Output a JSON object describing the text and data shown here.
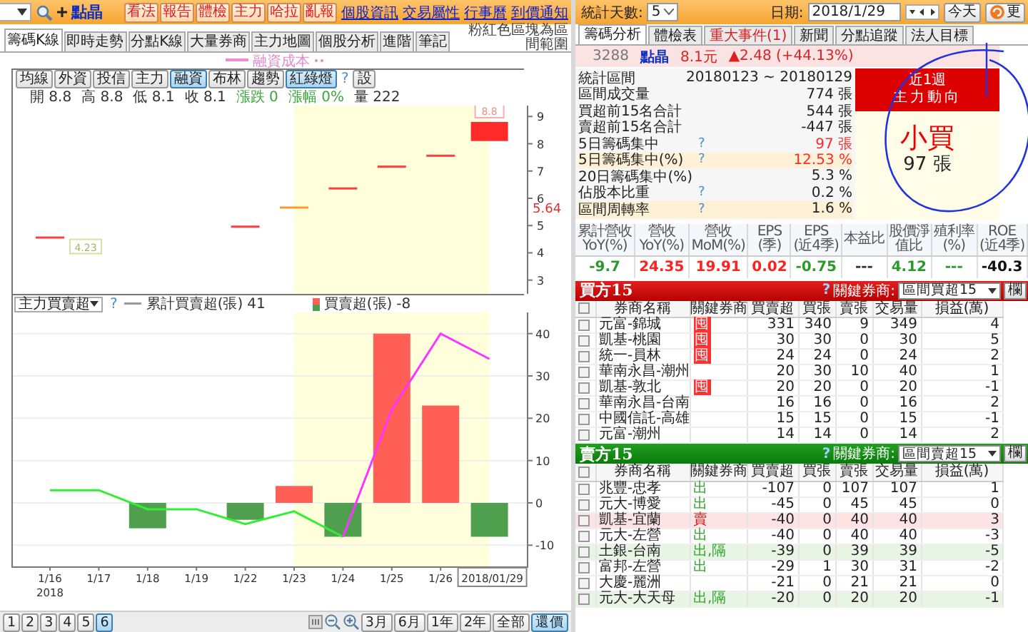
{
  "left_toolbar": {
    "stock_name": "點晶",
    "buttons": [
      "看法",
      "報告",
      "體檢",
      "主力",
      "哈拉",
      "亂報"
    ],
    "links": [
      "個股資訊",
      "交易屬性",
      "行事曆",
      "到價通知"
    ]
  },
  "left_tabs": [
    {
      "label": "籌碼K線",
      "selected": true
    },
    {
      "label": "即時走勢",
      "selected": false
    },
    {
      "label": "分點K線",
      "selected": false
    },
    {
      "label": "大量券商",
      "selected": false
    },
    {
      "label": "主力地圖",
      "selected": false
    },
    {
      "label": "個股分析",
      "selected": false
    },
    {
      "label": "進階",
      "selected": false
    },
    {
      "label": "筆記",
      "selected": false
    }
  ],
  "left_note": "粉紅色區塊為區間範圍",
  "overlay_legend": "融資成本",
  "chart_buttons": [
    {
      "label": "均線",
      "selected": false
    },
    {
      "label": "外資",
      "selected": false
    },
    {
      "label": "投信",
      "selected": false
    },
    {
      "label": "主力",
      "selected": false
    },
    {
      "label": "融資",
      "selected": true
    },
    {
      "label": "布林",
      "selected": false
    },
    {
      "label": "趨勢",
      "selected": false
    },
    {
      "label": "紅綠燈",
      "selected": true
    }
  ],
  "chart_help": "?",
  "chart_settings": "設",
  "ohlc": [
    {
      "label": "開",
      "value": "8.8",
      "color": "#333333"
    },
    {
      "label": "高",
      "value": "8.8",
      "color": "#333333"
    },
    {
      "label": "低",
      "value": "8.1",
      "color": "#333333"
    },
    {
      "label": "收",
      "value": "8.1",
      "color": "#333333"
    },
    {
      "label": "漲跌",
      "value": "0",
      "color": "#3aa63a"
    },
    {
      "label": "漲幅",
      "value": "0%",
      "color": "#3aa63a"
    },
    {
      "label": "量",
      "value": "222",
      "color": "#333333"
    }
  ],
  "price_chart": {
    "y_labels": [
      "9",
      "8",
      "7",
      "6",
      "5",
      "4",
      "3"
    ],
    "marker_label": "5.64",
    "low_label": "4.23",
    "high_label": "8.8"
  },
  "flow_chart": {
    "indicator": "主力買賣超",
    "help": "?",
    "legend_values": [
      "41",
      "-8"
    ],
    "x_year": "2018",
    "chart_data": {
      "type": "bar",
      "categories": [
        "1/16",
        "1/17",
        "1/18",
        "1/19",
        "1/22",
        "1/23",
        "1/24",
        "1/25",
        "1/26",
        "2018/01/29"
      ],
      "stacked": true,
      "grid": true,
      "series": [
        {
          "name": "買賣超(張)",
          "color": "#ff5f55",
          "values": [
            null,
            null,
            null,
            null,
            null,
            4,
            null,
            40,
            23,
            null
          ]
        },
        {
          "color": "#4f9f4f",
          "values": [
            null,
            null,
            -6,
            null,
            -4,
            null,
            -8,
            null,
            null,
            -8
          ]
        },
        {
          "name": "累計買賣超(張)",
          "type": "line",
          "color": "#33ee33",
          "values": [
            3,
            3,
            -1.5,
            -1.5,
            -5,
            -2,
            -8,
            null,
            null,
            null
          ]
        },
        {
          "type": "line",
          "color": "#ff33ff",
          "values": [
            null,
            null,
            null,
            null,
            null,
            null,
            -8,
            22,
            40,
            34
          ]
        }
      ],
      "ylim": [
        -15,
        45
      ],
      "yticks": [
        -10,
        0,
        10,
        20,
        30,
        40
      ],
      "bands": [
        {
          "axis": "x",
          "from": "1/23",
          "to": "2018/01/29",
          "color": "#ffffdc"
        }
      ]
    }
  },
  "bottom_bar": {
    "pages": [
      {
        "label": "1",
        "selected": false
      },
      {
        "label": "2",
        "selected": false
      },
      {
        "label": "3",
        "selected": false
      },
      {
        "label": "4",
        "selected": false
      },
      {
        "label": "5",
        "selected": false
      },
      {
        "label": "6",
        "selected": true
      }
    ],
    "ranges": [
      {
        "label": "3月",
        "selected": false
      },
      {
        "label": "6月",
        "selected": false
      },
      {
        "label": "1年",
        "selected": false
      },
      {
        "label": "2年",
        "selected": false
      },
      {
        "label": "全部",
        "selected": false
      },
      {
        "label": "還價",
        "selected": true
      }
    ]
  },
  "right_toolbar": {
    "days_label": "統計天數:",
    "days": "5",
    "date_label": "日期:",
    "date": "2018/1/29",
    "today_button": "今天",
    "refresh_button": "更"
  },
  "right_tabs": [
    {
      "label": "籌碼分析",
      "selected": true,
      "alert": false
    },
    {
      "label": "體檢表",
      "selected": false,
      "alert": false
    },
    {
      "label": "重大事件(1)",
      "selected": false,
      "alert": true
    },
    {
      "label": "新聞",
      "selected": false,
      "alert": false
    },
    {
      "label": "分點追蹤",
      "selected": false,
      "alert": false
    },
    {
      "label": "法人目標",
      "selected": false,
      "alert": false
    }
  ],
  "quote": {
    "code": "3288",
    "name": "點晶",
    "price": "8.1元",
    "change": "▲2.48 (+44.13%)"
  },
  "stats": [
    {
      "label": "統計區間",
      "value": "20180123 ~ 20180129",
      "help": false,
      "highlight": false,
      "alert": false
    },
    {
      "label": "區間成交量",
      "value": "774 張",
      "help": false,
      "highlight": false,
      "alert": false
    },
    {
      "label": "買超前15名合計",
      "value": "544 張",
      "help": false,
      "highlight": false,
      "alert": false
    },
    {
      "label": "賣超前15名合計",
      "value": "-447 張",
      "help": false,
      "highlight": false,
      "alert": false
    },
    {
      "label": "5日籌碼集中",
      "value": "97 張",
      "help": true,
      "highlight": false,
      "alert": true
    },
    {
      "label": "5日籌碼集中(%)",
      "value": "12.53 %",
      "help": true,
      "highlight": true,
      "alert": true
    },
    {
      "label": "20日籌碼集中(%)",
      "value": "5.3 %",
      "help": false,
      "highlight": false,
      "alert": false
    },
    {
      "label": "佔股本比重",
      "value": "0.2 %",
      "help": true,
      "highlight": false,
      "alert": false
    },
    {
      "label": "區間周轉率",
      "value": "1.6 %",
      "help": true,
      "highlight": true,
      "alert": false
    }
  ],
  "help_mark": "?",
  "trend_card": {
    "title": "近1週",
    "subtitle": "主力動向",
    "verdict": "小買",
    "amount": "97 張"
  },
  "fundamentals": [
    {
      "header": "累計營收\nYoY(%)",
      "value": "-9.7",
      "color": "#2a9a2a"
    },
    {
      "header": "營收\nYoY(%)",
      "value": "24.35",
      "color": "#ff2020"
    },
    {
      "header": "營收\nMoM(%)",
      "value": "19.91",
      "color": "#ff2020"
    },
    {
      "header": "EPS\n(季)",
      "value": "0.02",
      "color": "#ff2020"
    },
    {
      "header": "EPS\n(近4季)",
      "value": "-0.75",
      "color": "#2a9a2a"
    },
    {
      "header": "本益比",
      "value": "---",
      "color": "#333333"
    },
    {
      "header": "股價淨值比",
      "value": "4.12",
      "color": "#2a9a2a"
    },
    {
      "header": "殖利率\n(%)",
      "value": "---",
      "color": "#2a9a2a"
    },
    {
      "header": "ROE\n(近4季)",
      "value": "-40.3",
      "color": "#111111"
    }
  ],
  "buy_table": {
    "title": "買方15",
    "help": "?",
    "filter_label": "關鍵券商:",
    "filter": "區間買超15",
    "columns_button": "欄",
    "all_checked": false,
    "columns": [
      "券商名稱",
      "關鍵券商",
      "買賣超",
      "買張",
      "賣張",
      "交易量",
      "損益(萬)"
    ],
    "rows": [
      {
        "checked": false,
        "color": "#ff3030",
        "cells": [
          "元富-錦城",
          "囤",
          "331",
          "340",
          "9",
          "349",
          "4"
        ]
      },
      {
        "checked": false,
        "color": "#ff3030",
        "cells": [
          "凱基-桃園",
          "囤",
          "30",
          "30",
          "0",
          "30",
          "5"
        ]
      },
      {
        "checked": false,
        "color": "#ff3030",
        "cells": [
          "統一-員林",
          "囤",
          "24",
          "24",
          "0",
          "24",
          "2"
        ]
      },
      {
        "checked": false,
        "cells": [
          "華南永昌-潮州",
          "",
          "20",
          "30",
          "10",
          "40",
          "1"
        ]
      },
      {
        "checked": false,
        "color": "#ff3030",
        "cells": [
          "凱基-敦北",
          "囤",
          "20",
          "20",
          "0",
          "20",
          "-1"
        ]
      },
      {
        "checked": false,
        "cells": [
          "華南永昌-台南",
          "",
          "16",
          "16",
          "0",
          "16",
          "2"
        ]
      },
      {
        "checked": false,
        "cells": [
          "中國信託-高雄",
          "",
          "15",
          "15",
          "0",
          "15",
          "-1"
        ]
      },
      {
        "checked": false,
        "cells": [
          "元富-潮州",
          "",
          "14",
          "14",
          "0",
          "14",
          "2"
        ]
      }
    ]
  },
  "sell_table": {
    "title": "賣方15",
    "help": "?",
    "filter_label": "關鍵券商:",
    "filter": "區間賣超15",
    "columns_button": "欄",
    "all_checked": false,
    "columns": [
      "券商名稱",
      "關鍵券商",
      "買賣超",
      "買張",
      "賣張",
      "交易量",
      "損益(萬)"
    ],
    "rows": [
      {
        "checked": false,
        "kind": "normal",
        "color": "#2fa62f",
        "cells": [
          "兆豐-忠孝",
          "出",
          "-107",
          "0",
          "107",
          "107",
          "1"
        ]
      },
      {
        "checked": false,
        "kind": "normal",
        "color": "#2fa62f",
        "cells": [
          "元大-博愛",
          "出",
          "-45",
          "0",
          "45",
          "45",
          "0"
        ]
      },
      {
        "checked": false,
        "kind": "alert",
        "color": "#e01010",
        "cells": [
          "凱基-宜蘭",
          "賣",
          "-40",
          "0",
          "40",
          "40",
          "3"
        ]
      },
      {
        "checked": false,
        "kind": "normal",
        "color": "#2fa62f",
        "cells": [
          "元大-左營",
          "出",
          "-40",
          "0",
          "40",
          "40",
          "-3"
        ]
      },
      {
        "checked": false,
        "kind": "exit",
        "color": "#2fa62f",
        "cells": [
          "土銀-台南",
          "出,隔",
          "-39",
          "0",
          "39",
          "39",
          "-5"
        ]
      },
      {
        "checked": false,
        "kind": "normal",
        "color": "#2fa62f",
        "cells": [
          "富邦-左營",
          "出",
          "-29",
          "1",
          "30",
          "31",
          "-2"
        ]
      },
      {
        "checked": false,
        "kind": "normal",
        "cells": [
          "大慶-麗洲",
          "",
          "-21",
          "0",
          "21",
          "21",
          "0"
        ]
      },
      {
        "checked": false,
        "kind": "exit",
        "color": "#2fa62f",
        "cells": [
          "元大-大天母",
          "出,隔",
          "-20",
          "0",
          "20",
          "20",
          "-1"
        ]
      }
    ]
  }
}
